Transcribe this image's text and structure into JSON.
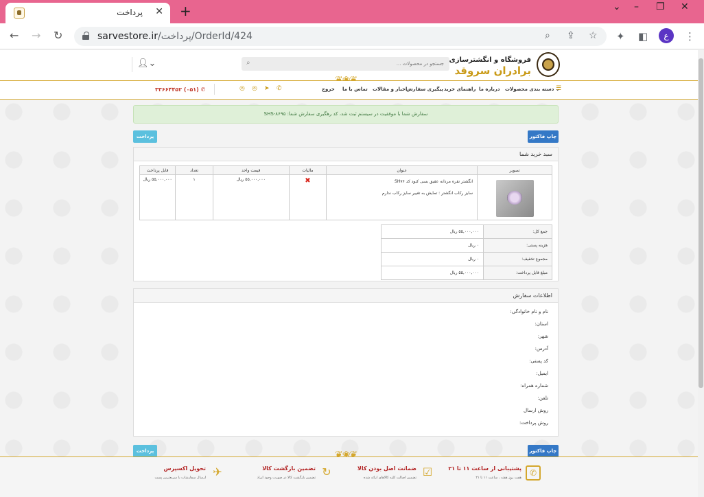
{
  "browser": {
    "tab_title": "پرداخت",
    "url_host": "sarvestore.ir",
    "url_path": "/پرداخت/OrderId/424",
    "profile_initial": "ع"
  },
  "header": {
    "logo_line1": "فروشگاه و انگشترسازی",
    "logo_line2": "برادران سروقد",
    "search_placeholder": "جستجو در محصولات ..."
  },
  "menu": {
    "categories": "دسته بندی محصولات",
    "about": "درباره ما",
    "guide": "راهنمای خرید",
    "tracking": "پیگیری سفارش",
    "news": "اخبار و مقالات",
    "contact": "تماس با ما",
    "logout": "خروج",
    "phone": "(۰۵۱) ۳۳۶۶۴۴۵۲"
  },
  "alert": {
    "text": "سفارش شما با موفقیت در سیستم ثبت شد، کد رهگیری سفارش شما: SHS-۸۶۹۵"
  },
  "buttons": {
    "print_invoice": "چاپ فاکتور",
    "pay": "پرداخت"
  },
  "cart": {
    "title": "سبد خرید شما",
    "columns": [
      "تصویر",
      "عنوان",
      "مالیات",
      "قیمت واحد",
      "تعداد",
      "قابل پرداخت"
    ],
    "item": {
      "title": "انگشتر نقره مردانه عقیق بسی کبود کد SH۷۶",
      "size_note": "سایز رکاب انگشتر : تمایش به تغییر سایز رکاب ندارم",
      "unit_price": "۵۵,۰۰۰,۰۰۰ ریال",
      "quantity": "۱",
      "payable": "۵۵,۰۰۰,۰۰۰ ریال"
    },
    "totals": [
      {
        "label": "جمع کل:",
        "value": "۵۵,۰۰۰,۰۰۰ ریال"
      },
      {
        "label": "هزینه پستی:",
        "value": "۰ ریال"
      },
      {
        "label": "مجموع تخفیف:",
        "value": "۰ ریال"
      },
      {
        "label": "مبلغ قابل پرداخت:",
        "value": "۵۵,۰۰۰,۰۰۰ ریال"
      }
    ]
  },
  "order_info": {
    "title": "اطلاعات سفارش",
    "fields": [
      "نام و نام خانوادگی:",
      "استان:",
      "شهر:",
      "آدرس:",
      "کد پستی:",
      "ایمیل:",
      "شماره همراه:",
      "تلفن:",
      "روش ارسال",
      "روش پرداخت:"
    ]
  },
  "footer": {
    "features": [
      {
        "title": "پشتیبانی از ساعت ۱۱ تا ۲۱",
        "sub": "هفت روز هفته ، ساعت ۱۱ تا ۲۱",
        "icon": "phone-icon"
      },
      {
        "title": "ضمانت اصل بودن کالا",
        "sub": "تضمین اصالت کلیه کالاهای ارائه شده",
        "icon": "check-icon"
      },
      {
        "title": "تضمین بازگشت کالا",
        "sub": "تضمین بازگشت کالا در صورت وجود ایراد",
        "icon": "refresh-icon"
      },
      {
        "title": "تحویل اکسپرس",
        "sub": "ارسال سفارشات با سریعترین پست",
        "icon": "plane-icon"
      }
    ]
  },
  "colors": {
    "browser_tab_bar": "#e8658f",
    "gold": "#d4a72c",
    "alert_bg": "#dff0d8",
    "button_blue": "#3478c6",
    "button_cyan": "#5bc0de"
  }
}
